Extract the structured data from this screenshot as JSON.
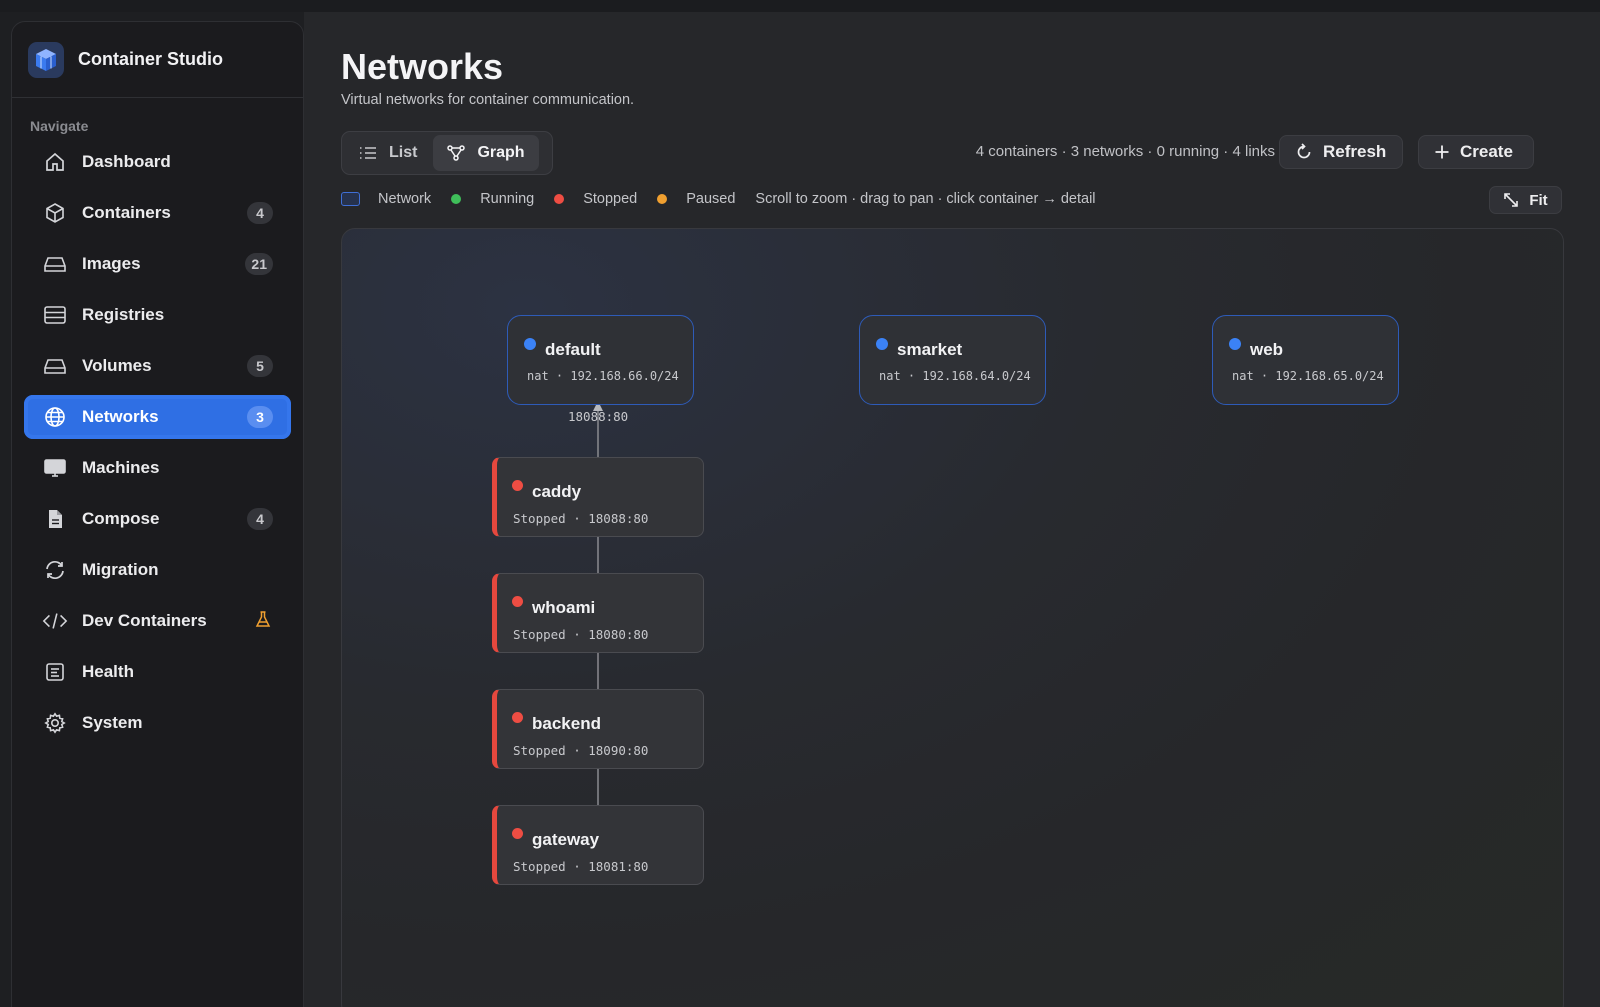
{
  "app": {
    "title": "Container Studio"
  },
  "sidebar": {
    "heading": "Navigate",
    "items": [
      {
        "label": "Dashboard",
        "icon": "house-icon",
        "count": null
      },
      {
        "label": "Containers",
        "icon": "cube-icon",
        "count": "4"
      },
      {
        "label": "Images",
        "icon": "drive-icon",
        "count": "21"
      },
      {
        "label": "Registries",
        "icon": "server-icon",
        "count": null
      },
      {
        "label": "Volumes",
        "icon": "drive-icon",
        "count": "5"
      },
      {
        "label": "Networks",
        "icon": "globe-icon",
        "count": "3",
        "active": true
      },
      {
        "label": "Machines",
        "icon": "monitor-icon",
        "count": null
      },
      {
        "label": "Compose",
        "icon": "document-icon",
        "count": "4"
      },
      {
        "label": "Migration",
        "icon": "sync-icon",
        "count": null
      },
      {
        "label": "Dev Containers",
        "icon": "code-icon",
        "badge": "flask-icon"
      },
      {
        "label": "Health",
        "icon": "health-icon",
        "count": null
      },
      {
        "label": "System",
        "icon": "gear-icon",
        "count": null
      }
    ]
  },
  "header": {
    "title": "Networks",
    "subtitle": "Virtual networks for container communication."
  },
  "view_toggle": {
    "list": "List",
    "graph": "Graph",
    "selected": "Graph"
  },
  "stats": "4 containers · 3 networks · 0 running · 4 links",
  "buttons": {
    "refresh": "Refresh",
    "create": "Create",
    "fit": "Fit"
  },
  "legend": {
    "network": "Network",
    "running": "Running",
    "stopped": "Stopped",
    "paused": "Paused",
    "hint": "Scroll to zoom · drag to pan · click container → detail"
  },
  "colors": {
    "accent": "#2f6fe4",
    "network": "#3b82f6",
    "running": "#3fbf5a",
    "stopped": "#ee4d43",
    "paused": "#f0a030"
  },
  "graph": {
    "networks": [
      {
        "name": "default",
        "sub": "nat · 192.168.66.0/24"
      },
      {
        "name": "smarket",
        "sub": "nat · 192.168.64.0/24"
      },
      {
        "name": "web",
        "sub": "nat · 192.168.65.0/24"
      }
    ],
    "containers": [
      {
        "name": "caddy",
        "sub": "Stopped · 18088:80",
        "status": "stopped"
      },
      {
        "name": "whoami",
        "sub": "Stopped · 18080:80",
        "status": "stopped"
      },
      {
        "name": "backend",
        "sub": "Stopped · 18090:80",
        "status": "stopped"
      },
      {
        "name": "gateway",
        "sub": "Stopped · 18081:80",
        "status": "stopped"
      }
    ],
    "edge_label": "18088:80"
  }
}
